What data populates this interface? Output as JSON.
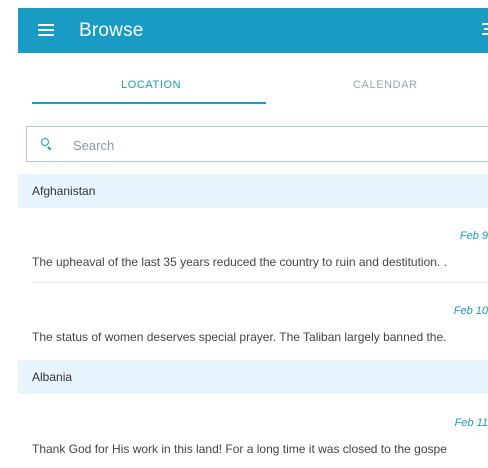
{
  "appbar": {
    "title": "Browse",
    "menu_icon": "hamburger-menu-icon",
    "filter_icon": "filter-icon",
    "color": "#1a9bc4"
  },
  "tabs": [
    {
      "label": "LOCATION",
      "active": true
    },
    {
      "label": "CALENDAR",
      "active": false
    }
  ],
  "search": {
    "placeholder": "Search",
    "value": "",
    "icon": "search-icon"
  },
  "sections": [
    {
      "country": "Afghanistan",
      "entries": [
        {
          "date": "Feb 9",
          "text": "The upheaval of the last 35 years reduced the country to ruin and destitution. ."
        },
        {
          "date": "Feb 10",
          "text": "The status of women deserves special prayer. The Taliban largely banned the."
        }
      ]
    },
    {
      "country": "Albania",
      "entries": [
        {
          "date": "Feb 11",
          "text": "Thank God for His work in this land! For a long time it was closed to the gospe"
        }
      ]
    }
  ]
}
